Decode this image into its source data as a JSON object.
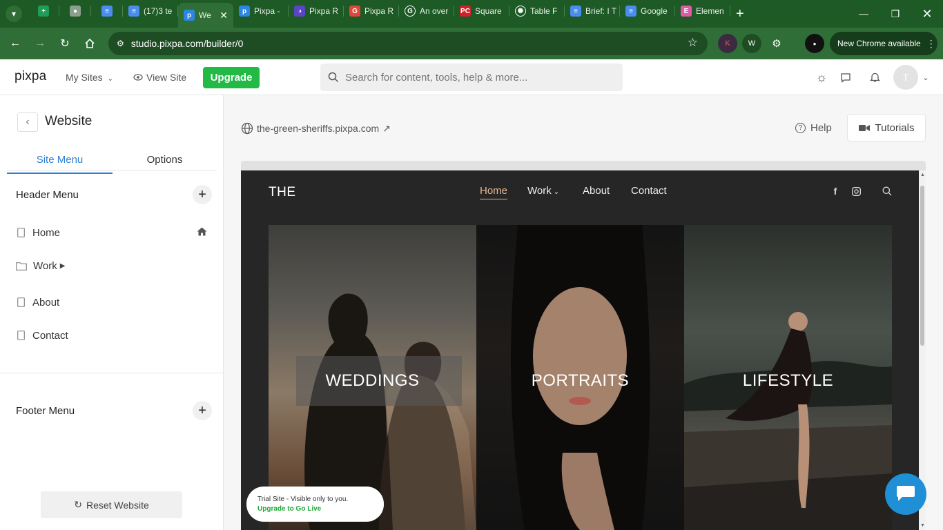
{
  "browser": {
    "tabs": [
      {
        "title": "",
        "icon": "sheets-icon",
        "color": "#1e9e57"
      },
      {
        "title": "",
        "icon": "globe-icon",
        "color": "#8ba08c"
      },
      {
        "title": "",
        "icon": "docs-icon",
        "color": "#4a8cf0"
      },
      {
        "title": "(17)3 tе",
        "icon": "docs-icon",
        "color": "#4a8cf0"
      },
      {
        "title": "We",
        "icon": "pixpa-icon",
        "color": "#2b86e6",
        "active": true
      },
      {
        "title": "Pixpa -",
        "icon": "pixpa-icon",
        "color": "#2b86e6"
      },
      {
        "title": "Pixpa R",
        "icon": "pixpa-alt-icon",
        "color": "#5a45c9"
      },
      {
        "title": "Pixpa R",
        "icon": "g-red-icon",
        "color": "#e2463a"
      },
      {
        "title": "An over",
        "icon": "google-icon",
        "color": "#ffffff"
      },
      {
        "title": "Square",
        "icon": "pc-icon",
        "color": "#d4202a"
      },
      {
        "title": "Table F",
        "icon": "openai-icon",
        "color": "#ffffff"
      },
      {
        "title": "Brief: I T",
        "icon": "docs-icon",
        "color": "#4a8cf0"
      },
      {
        "title": "Google",
        "icon": "docs-icon",
        "color": "#4a8cf0"
      },
      {
        "title": "Elemen",
        "icon": "elementor-icon",
        "color": "#e05aa9"
      }
    ],
    "url": "studio.pixpa.com/builder/0",
    "new_chrome": "New Chrome available"
  },
  "header": {
    "logo": "pixpa",
    "my_sites": "My Sites",
    "view_site": "View Site",
    "upgrade": "Upgrade",
    "search_placeholder": "Search for content, tools, help & more...",
    "avatar_initial": "T"
  },
  "sidebar": {
    "title": "Website",
    "tabs": [
      "Site Menu",
      "Options"
    ],
    "header_menu": "Header Menu",
    "items": [
      {
        "label": "Home",
        "icon": "page-icon"
      },
      {
        "label": "Work",
        "icon": "folder-icon"
      },
      {
        "label": "About",
        "icon": "page-icon"
      },
      {
        "label": "Contact",
        "icon": "page-icon"
      }
    ],
    "footer_menu": "Footer Menu",
    "reset": "Reset Website"
  },
  "main": {
    "site_url": "the-green-sheriffs.pixpa.com",
    "help": "Help",
    "tutorials": "Tutorials",
    "preview": {
      "logo": "THE",
      "nav": [
        "Home",
        "Work",
        "About",
        "Contact"
      ],
      "tiles": [
        "WEDDINGS",
        "PORTRAITS",
        "LIFESTYLE"
      ],
      "trial_text": "Trial Site - Visible only to you.",
      "trial_cta": "Upgrade to Go Live"
    }
  },
  "colors": {
    "accent": "#2b7fd9",
    "upgrade": "#22b945",
    "chrome_dark": "#1d5a25",
    "chrome_mid": "#2f6f37",
    "nav_active": "#e8b994",
    "chat": "#1f8fd6"
  }
}
